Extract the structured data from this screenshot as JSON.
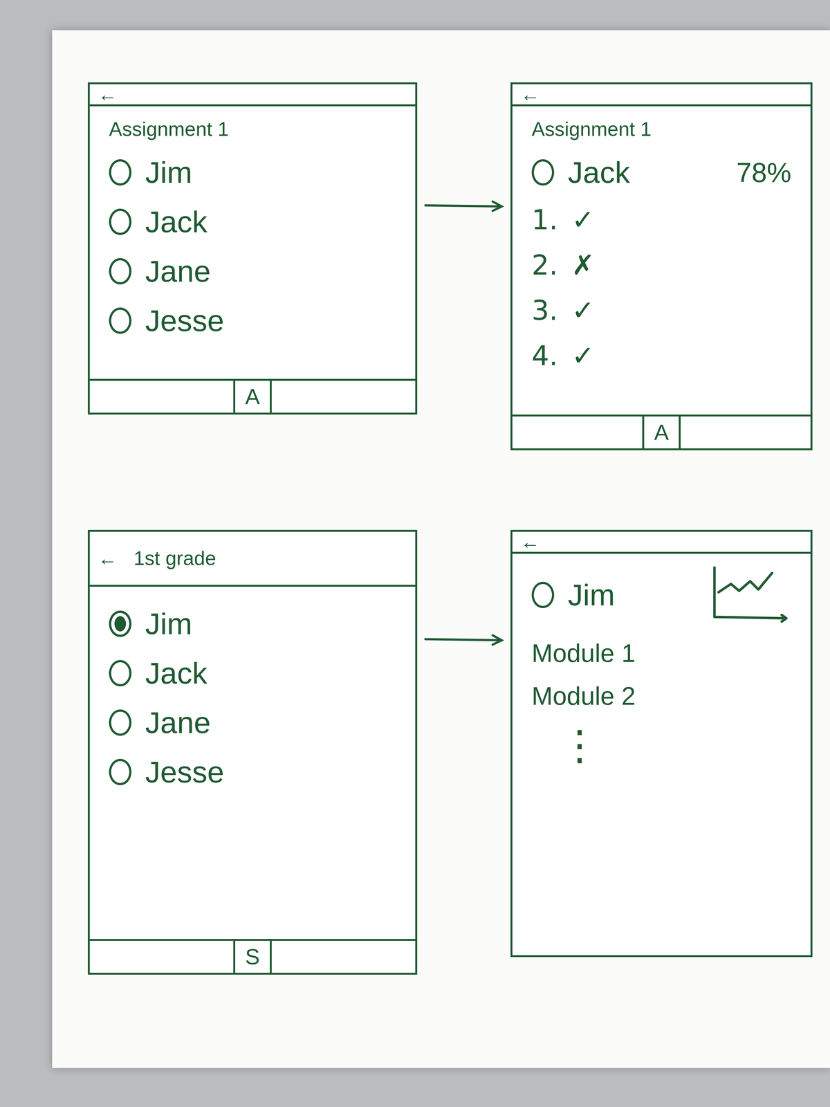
{
  "screens": [
    {
      "kind": "assignment-list",
      "back": "←",
      "title": "Assignment 1",
      "students": [
        {
          "name": "Jim",
          "selected": false
        },
        {
          "name": "Jack",
          "selected": false
        },
        {
          "name": "Jane",
          "selected": false
        },
        {
          "name": "Jesse",
          "selected": false
        }
      ],
      "tab": "A"
    },
    {
      "kind": "assignment-detail",
      "back": "←",
      "title": "Assignment 1",
      "student": {
        "name": "Jack",
        "selected": false
      },
      "score": "78%",
      "answers": [
        {
          "number": "1.",
          "mark": "✓"
        },
        {
          "number": "2.",
          "mark": "✗"
        },
        {
          "number": "3.",
          "mark": "✓"
        },
        {
          "number": "4.",
          "mark": "✓"
        }
      ],
      "tab": "A"
    },
    {
      "kind": "class-list",
      "back": "←",
      "title": "1st grade",
      "students": [
        {
          "name": "Jim",
          "selected": true
        },
        {
          "name": "Jack",
          "selected": false
        },
        {
          "name": "Jane",
          "selected": false
        },
        {
          "name": "Jesse",
          "selected": false
        }
      ],
      "tab": "S"
    },
    {
      "kind": "student-progress",
      "back": "←",
      "student": {
        "name": "Jim",
        "selected": false
      },
      "modules": [
        "Module 1",
        "Module 2"
      ],
      "more": "⋮"
    }
  ],
  "arrows": [
    {
      "from": 0,
      "to": 1
    },
    {
      "from": 2,
      "to": 3
    }
  ]
}
